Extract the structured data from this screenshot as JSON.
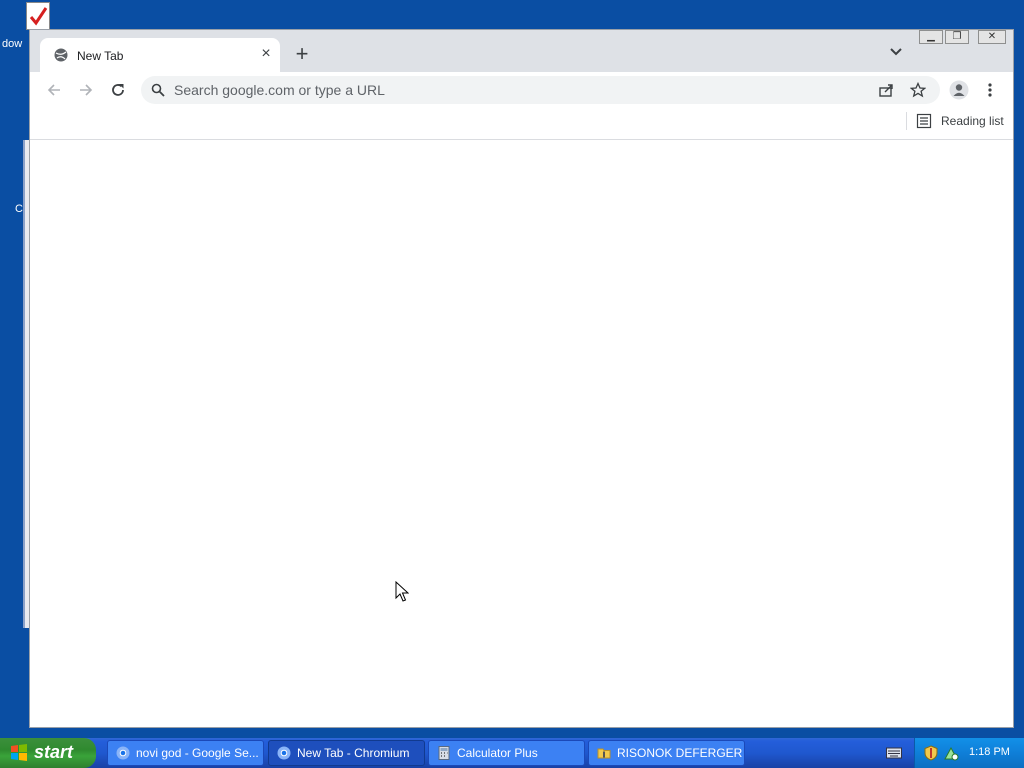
{
  "desktop": {
    "icon_label": "dow",
    "edge_label": "C"
  },
  "browser": {
    "tab": {
      "title": "New Tab"
    },
    "omnibox": {
      "placeholder": "Search google.com or type a URL"
    },
    "bookmarks_bar": {
      "reading_list_label": "Reading list"
    }
  },
  "taskbar": {
    "start_label": "start",
    "tasks": [
      {
        "label": "novi god - Google Se...",
        "icon": "chromium-icon"
      },
      {
        "label": "New Tab - Chromium",
        "icon": "chromium-icon"
      },
      {
        "label": "Calculator Plus",
        "icon": "calculator-icon"
      },
      {
        "label": "RISONOK DEFERGER",
        "icon": "folder-icon"
      }
    ],
    "clock": "1:18 PM"
  }
}
